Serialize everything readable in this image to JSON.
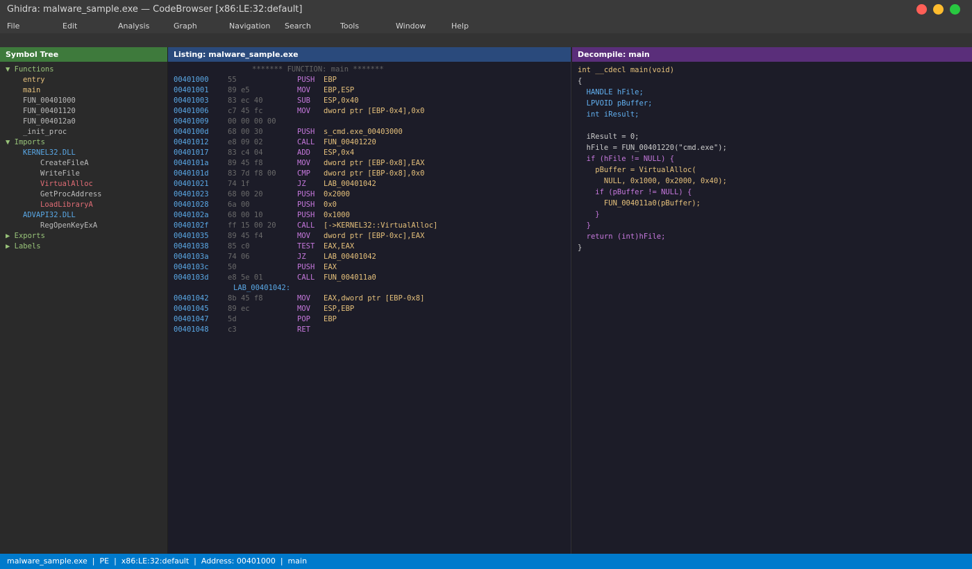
{
  "window": {
    "title": "Ghidra: malware_sample.exe — CodeBrowser [x86:LE:32:default]",
    "controls": [
      {
        "name": "close",
        "color": "#ff5f57"
      },
      {
        "name": "minimize",
        "color": "#febc2e"
      },
      {
        "name": "maximize",
        "color": "#28c840"
      }
    ]
  },
  "menu": [
    "File",
    "Edit",
    "Analysis",
    "Graph",
    "Navigation",
    "Search",
    "Tools",
    "Window",
    "Help"
  ],
  "symbol_tree": {
    "title": "Symbol Tree",
    "rows": [
      {
        "text": "▼ Functions",
        "indent": 0,
        "color": "#98c379"
      },
      {
        "text": "entry",
        "indent": 2,
        "color": "#e5c07b"
      },
      {
        "text": "main",
        "indent": 2,
        "color": "#e5c07b"
      },
      {
        "text": "FUN_00401000",
        "indent": 2,
        "color": "#bbbbbb"
      },
      {
        "text": "FUN_00401120",
        "indent": 2,
        "color": "#bbbbbb"
      },
      {
        "text": "FUN_004012a0",
        "indent": 2,
        "color": "#bbbbbb"
      },
      {
        "text": "_init_proc",
        "indent": 2,
        "color": "#bbbbbb"
      },
      {
        "text": "▼ Imports",
        "indent": 0,
        "color": "#98c379"
      },
      {
        "text": "KERNEL32.DLL",
        "indent": 2,
        "color": "#5aa8e6"
      },
      {
        "text": "CreateFileA",
        "indent": 4,
        "color": "#bbbbbb"
      },
      {
        "text": "WriteFile",
        "indent": 4,
        "color": "#bbbbbb"
      },
      {
        "text": "VirtualAlloc",
        "indent": 4,
        "color": "#e06c75"
      },
      {
        "text": "GetProcAddress",
        "indent": 4,
        "color": "#bbbbbb"
      },
      {
        "text": "LoadLibraryA",
        "indent": 4,
        "color": "#e06c75"
      },
      {
        "text": "ADVAPI32.DLL",
        "indent": 2,
        "color": "#5aa8e6"
      },
      {
        "text": "RegOpenKeyExA",
        "indent": 4,
        "color": "#bbbbbb"
      },
      {
        "text": "▶ Exports",
        "indent": 0,
        "color": "#98c379"
      },
      {
        "text": "▶ Labels",
        "indent": 0,
        "color": "#98c379"
      }
    ]
  },
  "listing": {
    "title": "Listing: malware_sample.exe",
    "function_header": "******* FUNCTION: main *******",
    "label": "LAB_00401042:",
    "rows": [
      {
        "addr": "00401000",
        "bytes": "55",
        "mnem": "PUSH",
        "ops": "EBP"
      },
      {
        "addr": "00401001",
        "bytes": "89 e5",
        "mnem": "MOV",
        "ops": "EBP,ESP"
      },
      {
        "addr": "00401003",
        "bytes": "83 ec 40",
        "mnem": "SUB",
        "ops": "ESP,0x40"
      },
      {
        "addr": "00401006",
        "bytes": "c7 45 fc",
        "mnem": "MOV",
        "ops": "dword ptr [EBP-0x4],0x0"
      },
      {
        "addr": "00401009",
        "bytes": "00 00 00 00",
        "mnem": "",
        "ops": ""
      },
      {
        "addr": "0040100d",
        "bytes": "68 00 30",
        "mnem": "PUSH",
        "ops": "s_cmd.exe_00403000"
      },
      {
        "addr": "00401012",
        "bytes": "e8 09 02",
        "mnem": "CALL",
        "ops": "FUN_00401220"
      },
      {
        "addr": "00401017",
        "bytes": "83 c4 04",
        "mnem": "ADD",
        "ops": "ESP,0x4"
      },
      {
        "addr": "0040101a",
        "bytes": "89 45 f8",
        "mnem": "MOV",
        "ops": "dword ptr [EBP-0x8],EAX"
      },
      {
        "addr": "0040101d",
        "bytes": "83 7d f8 00",
        "mnem": "CMP",
        "ops": "dword ptr [EBP-0x8],0x0"
      },
      {
        "addr": "00401021",
        "bytes": "74 1f",
        "mnem": "JZ",
        "ops": "LAB_00401042"
      },
      {
        "addr": "00401023",
        "bytes": "68 00 20",
        "mnem": "PUSH",
        "ops": "0x2000"
      },
      {
        "addr": "00401028",
        "bytes": "6a 00",
        "mnem": "PUSH",
        "ops": "0x0"
      },
      {
        "addr": "0040102a",
        "bytes": "68 00 10",
        "mnem": "PUSH",
        "ops": "0x1000"
      },
      {
        "addr": "0040102f",
        "bytes": "ff 15 00 20",
        "mnem": "CALL",
        "ops": "[->KERNEL32::VirtualAlloc]"
      },
      {
        "addr": "00401035",
        "bytes": "89 45 f4",
        "mnem": "MOV",
        "ops": "dword ptr [EBP-0xc],EAX"
      },
      {
        "addr": "00401038",
        "bytes": "85 c0",
        "mnem": "TEST",
        "ops": "EAX,EAX"
      },
      {
        "addr": "0040103a",
        "bytes": "74 06",
        "mnem": "JZ",
        "ops": "LAB_00401042"
      },
      {
        "addr": "0040103c",
        "bytes": "50",
        "mnem": "PUSH",
        "ops": "EAX"
      },
      {
        "addr": "0040103d",
        "bytes": "e8 5e 01",
        "mnem": "CALL",
        "ops": "FUN_004011a0"
      },
      {
        "addr": "00401042",
        "bytes": "8b 45 f8",
        "mnem": "MOV",
        "ops": "EAX,dword ptr [EBP-0x8]"
      },
      {
        "addr": "00401045",
        "bytes": "89 ec",
        "mnem": "MOV",
        "ops": "ESP,EBP"
      },
      {
        "addr": "00401047",
        "bytes": "5d",
        "mnem": "POP",
        "ops": "EBP"
      },
      {
        "addr": "00401048",
        "bytes": "c3",
        "mnem": "RET",
        "ops": ""
      }
    ]
  },
  "decompile": {
    "title": "Decompile: main",
    "lines": [
      {
        "text": "int __cdecl main(void)",
        "color": "#e5c07b"
      },
      {
        "text": "{",
        "color": "#cccccc"
      },
      {
        "text": "  HANDLE hFile;",
        "color": "#61afef"
      },
      {
        "text": "  LPVOID pBuffer;",
        "color": "#61afef"
      },
      {
        "text": "  int iResult;",
        "color": "#61afef"
      },
      {
        "text": "",
        "color": "#cccccc"
      },
      {
        "text": "  iResult = 0;",
        "color": "#cccccc"
      },
      {
        "text": "  hFile = FUN_00401220(\"cmd.exe\");",
        "color": "#cccccc"
      },
      {
        "text": "  if (hFile != NULL) {",
        "color": "#c678dd"
      },
      {
        "text": "    pBuffer = VirtualAlloc(",
        "color": "#e5c07b"
      },
      {
        "text": "      NULL, 0x1000, 0x2000, 0x40);",
        "color": "#e5c07b"
      },
      {
        "text": "    if (pBuffer != NULL) {",
        "color": "#c678dd"
      },
      {
        "text": "      FUN_004011a0(pBuffer);",
        "color": "#e5c07b"
      },
      {
        "text": "    }",
        "color": "#c678dd"
      },
      {
        "text": "  }",
        "color": "#c678dd"
      },
      {
        "text": "  return (int)hFile;",
        "color": "#c678dd"
      },
      {
        "text": "}",
        "color": "#cccccc"
      }
    ]
  },
  "status": {
    "text": "malware_sample.exe  |  PE  |  x86:LE:32:default  |  Address: 00401000  |  main"
  }
}
